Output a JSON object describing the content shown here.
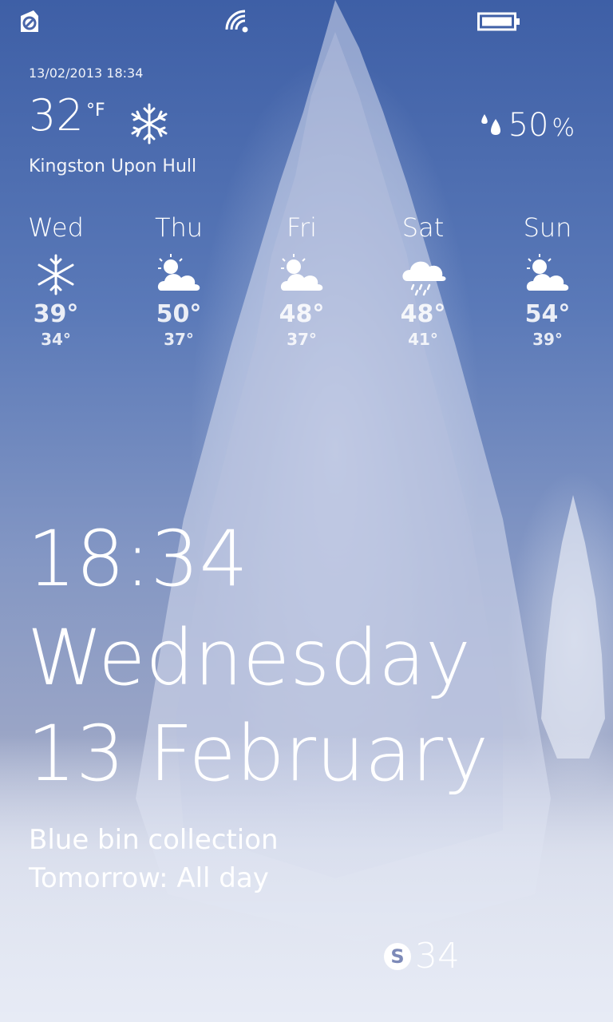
{
  "status_bar": {
    "icons": [
      "notification-icon",
      "wifi-icon",
      "battery-icon"
    ]
  },
  "weather": {
    "updated": "13/02/2013 18:34",
    "current_temp": "32",
    "unit": "°F",
    "current_condition_icon": "snowflake-icon",
    "location": "Kingston Upon Hull",
    "humidity_value": "50",
    "humidity_unit": "%",
    "forecast": [
      {
        "day": "Wed",
        "icon": "snowflake-icon",
        "high": "39°",
        "low": "34°"
      },
      {
        "day": "Thu",
        "icon": "partly-cloudy-icon",
        "high": "50°",
        "low": "37°"
      },
      {
        "day": "Fri",
        "icon": "partly-cloudy-icon",
        "high": "48°",
        "low": "37°"
      },
      {
        "day": "Sat",
        "icon": "rain-cloud-icon",
        "high": "48°",
        "low": "41°"
      },
      {
        "day": "Sun",
        "icon": "partly-cloudy-icon",
        "high": "54°",
        "low": "39°"
      }
    ]
  },
  "lockscreen": {
    "time": "18:34",
    "weekday": "Wednesday",
    "date": "13 February",
    "event_title": "Blue bin collection",
    "event_time": "Tomorrow: All day"
  },
  "notifications": {
    "skype_count": "34",
    "skype_icon": "skype-icon"
  }
}
